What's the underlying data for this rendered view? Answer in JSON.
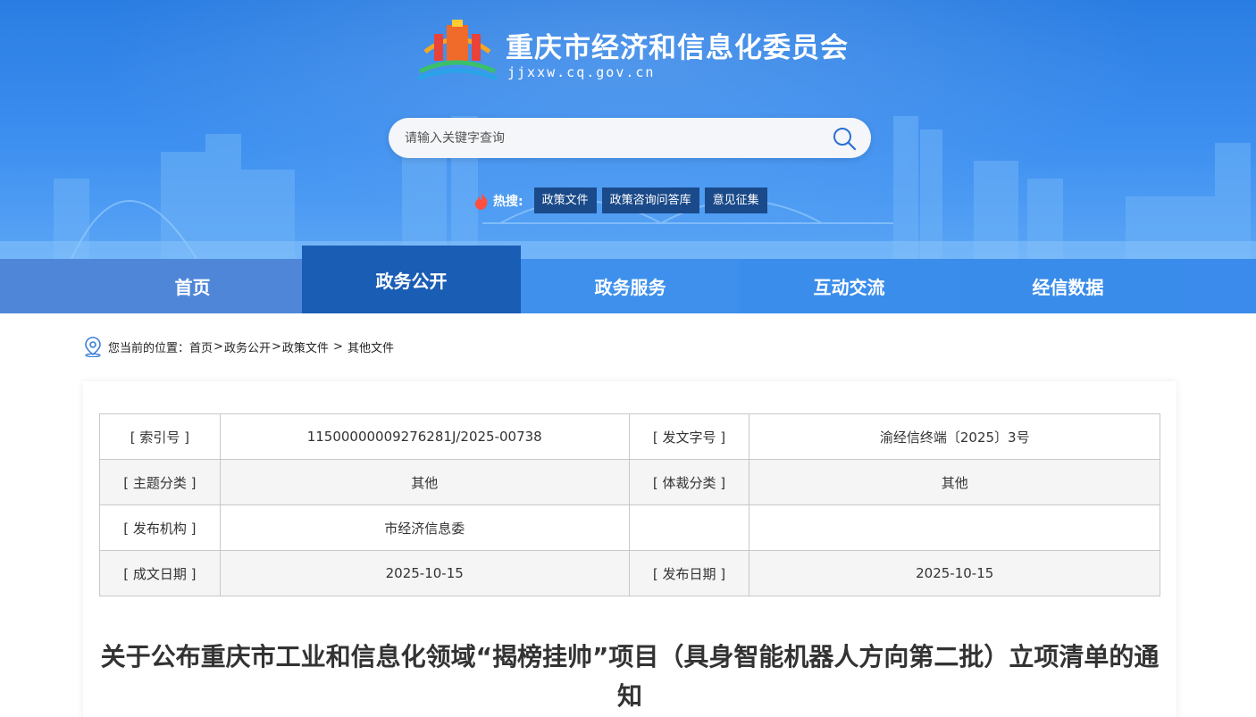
{
  "header": {
    "site_title": "重庆市经济和信息化委员会",
    "site_domain": "jjxxw.cq.gov.cn",
    "logo_icon": "city-hall-emblem-icon",
    "brand_color": "#2a7de2"
  },
  "search": {
    "placeholder": "请输入关键字查询",
    "value": "",
    "button_icon": "search-icon"
  },
  "hot_search": {
    "label": "热搜:",
    "icon": "flame-icon",
    "tags": [
      "政策文件",
      "政策咨询问答库",
      "意见征集"
    ]
  },
  "nav": {
    "items": [
      {
        "label": "首页",
        "active": false
      },
      {
        "label": "政务公开",
        "active": true
      },
      {
        "label": "政务服务",
        "active": false
      },
      {
        "label": "互动交流",
        "active": false
      },
      {
        "label": "经信数据",
        "active": false
      }
    ],
    "active_color": "#1a5db5"
  },
  "breadcrumb": {
    "icon": "location-pin-icon",
    "prefix": "您当前的位置：",
    "items": [
      "首页",
      "政务公开",
      "政策文件",
      "其他文件"
    ],
    "separators": [
      ">",
      ">",
      " > "
    ]
  },
  "meta_table": {
    "rows": [
      {
        "k1": "[ 索引号 ]",
        "v1": "11500000009276281J/2025-00738",
        "k2": "[ 发文字号 ]",
        "v2": "渝经信终端〔2025〕3号"
      },
      {
        "k1": "[ 主题分类 ]",
        "v1": "其他",
        "k2": "[ 体裁分类 ]",
        "v2": "其他"
      },
      {
        "k1": "[ 发布机构 ]",
        "v1": "市经济信息委",
        "k2": "",
        "v2": ""
      },
      {
        "k1": "[ 成文日期 ]",
        "v1": "2025-10-15",
        "k2": "[ 发布日期 ]",
        "v2": "2025-10-15"
      }
    ]
  },
  "document": {
    "title": "关于公布重庆市工业和信息化领域“揭榜挂帅”项目（具身智能机器人方向第二批）立项清单的通知"
  }
}
